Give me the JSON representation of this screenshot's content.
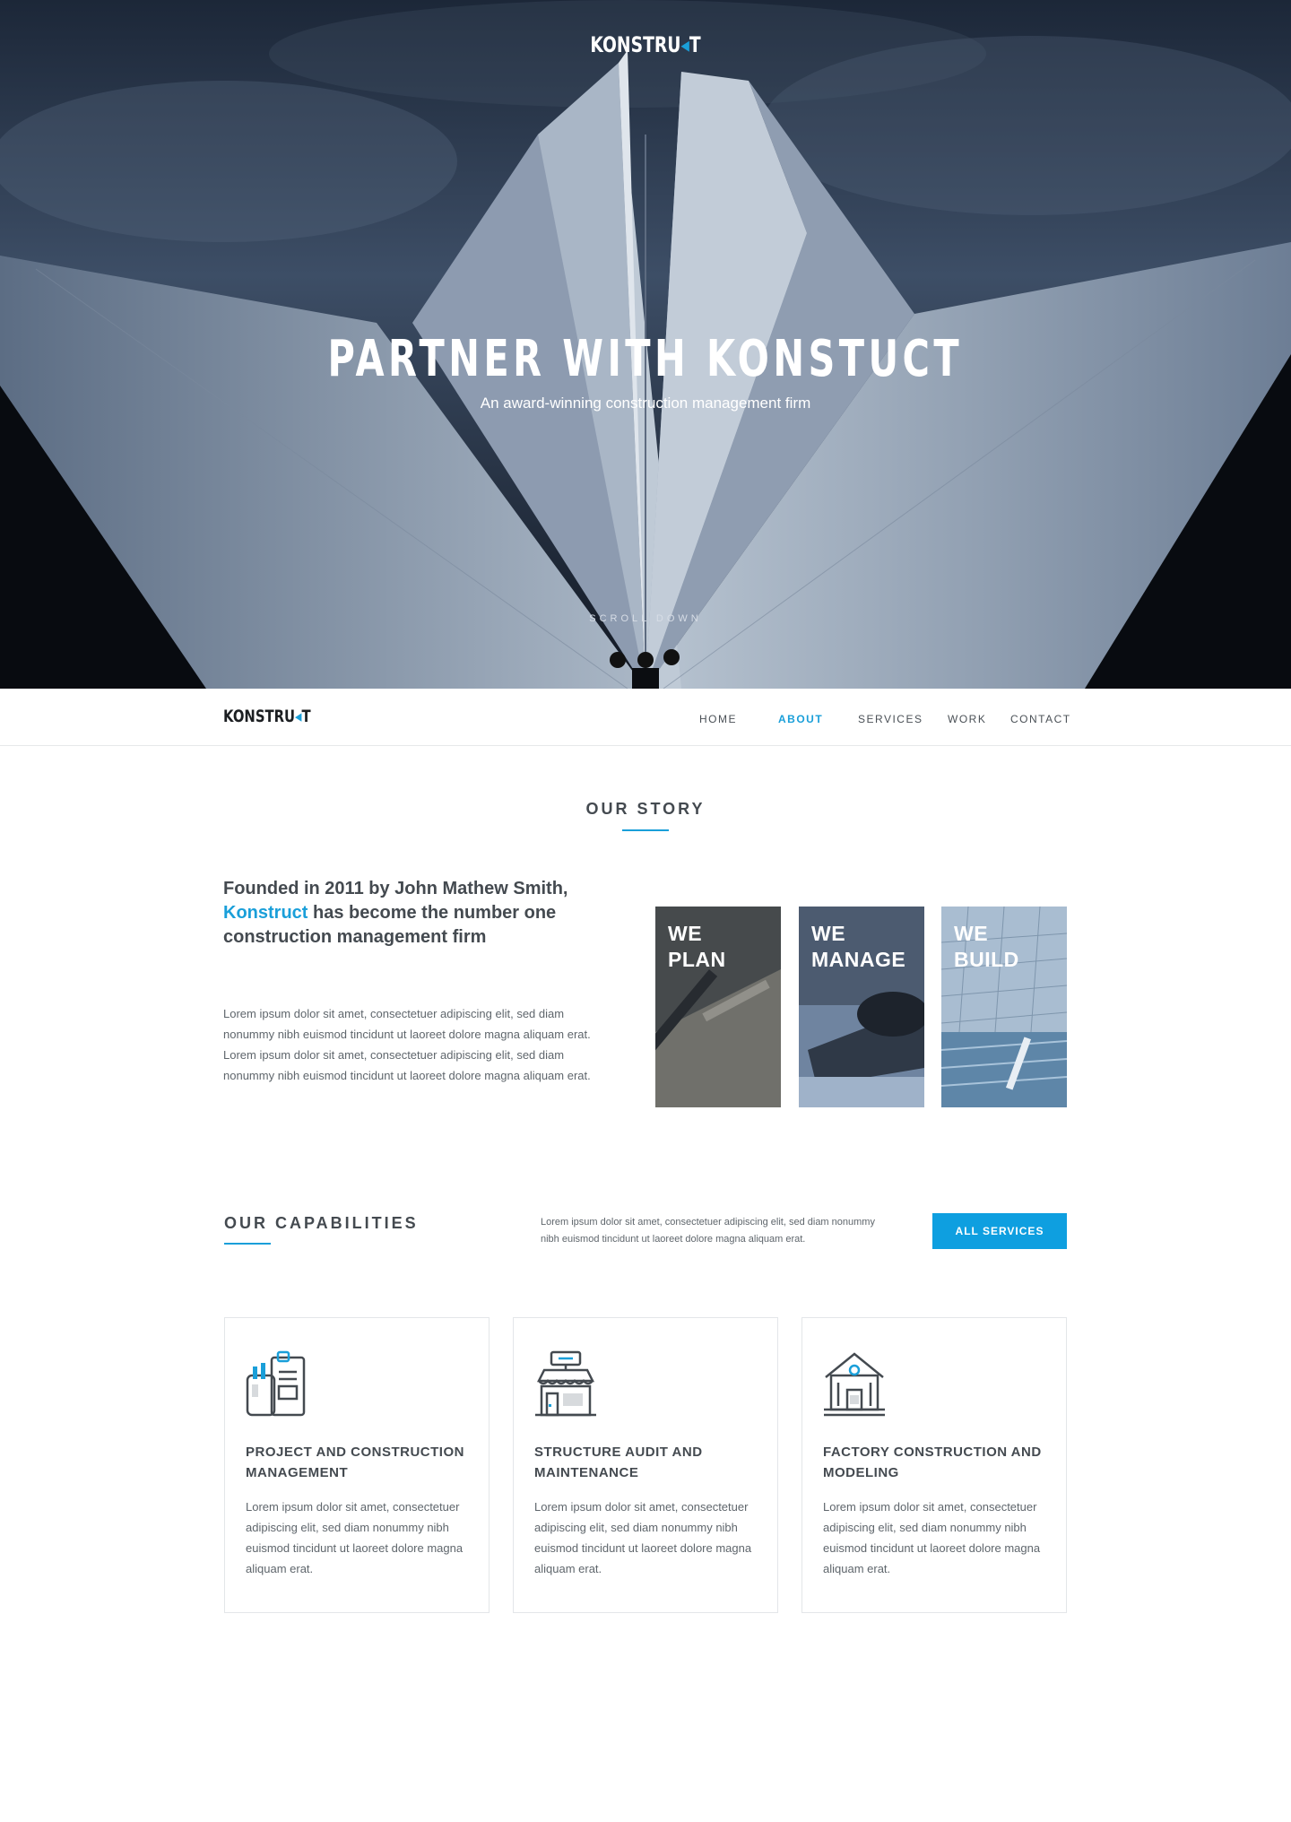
{
  "hero": {
    "logo_prefix": "KONSTRU",
    "logo_accent": "◂",
    "logo_suffix": "T",
    "title": "PARTNER WITH KONSTUCT",
    "subtitle": "An award-winning construction management firm",
    "scroll_label": "SCROLL DOWN"
  },
  "nav": {
    "logo_prefix": "KONSTRU",
    "logo_accent": "◂",
    "logo_suffix": "T",
    "items": [
      {
        "label": "HOME",
        "active": false
      },
      {
        "label": "ABOUT",
        "active": true
      },
      {
        "label": "SERVICES",
        "active": false
      },
      {
        "label": "WORK",
        "active": false
      },
      {
        "label": "CONTACT",
        "active": false
      }
    ]
  },
  "story": {
    "section_title": "OUR STORY",
    "heading_before": "Founded in 2011 by John Mathew Smith, ",
    "heading_accent": "Konstruct",
    "heading_after": " has become the number one construction management firm",
    "body": "Lorem ipsum dolor sit amet, consectetuer adipiscing elit, sed diam nonummy nibh euismod tincidunt ut laoreet dolore magna aliquam erat. Lorem ipsum dolor sit amet, consectetuer adipiscing elit, sed diam nonummy nibh euismod tincidunt ut laoreet dolore magna aliquam erat.",
    "tiles": [
      {
        "line1": "WE",
        "line2": "PLAN"
      },
      {
        "line1": "WE",
        "line2": "MANAGE"
      },
      {
        "line1": "WE",
        "line2": "BUILD"
      }
    ]
  },
  "capabilities": {
    "section_title": "OUR CAPABILITIES",
    "intro": "Lorem ipsum dolor sit amet, consectetuer adipiscing elit, sed diam nonummy nibh euismod tincidunt ut laoreet dolore magna aliquam erat.",
    "button_label": "ALL SERVICES",
    "cards": [
      {
        "icon": "clipboard-tools-icon",
        "title": "PROJECT AND CONSTRUCTION MANAGEMENT",
        "body": "Lorem ipsum dolor sit amet, consectetuer adipiscing elit, sed diam nonummy nibh euismod tincidunt ut laoreet dolore magna aliquam erat."
      },
      {
        "icon": "storefront-icon",
        "title": "STRUCTURE AUDIT AND MAINTENANCE",
        "body": "Lorem ipsum dolor sit amet, consectetuer adipiscing elit, sed diam nonummy nibh euismod tincidunt ut laoreet dolore magna aliquam erat."
      },
      {
        "icon": "factory-building-icon",
        "title": "FACTORY CONSTRUCTION AND MODELING",
        "body": "Lorem ipsum dolor sit amet, consectetuer adipiscing elit, sed diam nonummy nibh euismod tincidunt ut laoreet dolore magna aliquam erat."
      }
    ]
  },
  "colors": {
    "accent": "#1a9fd9",
    "button": "#0e9fe0",
    "text": "#444a50"
  }
}
